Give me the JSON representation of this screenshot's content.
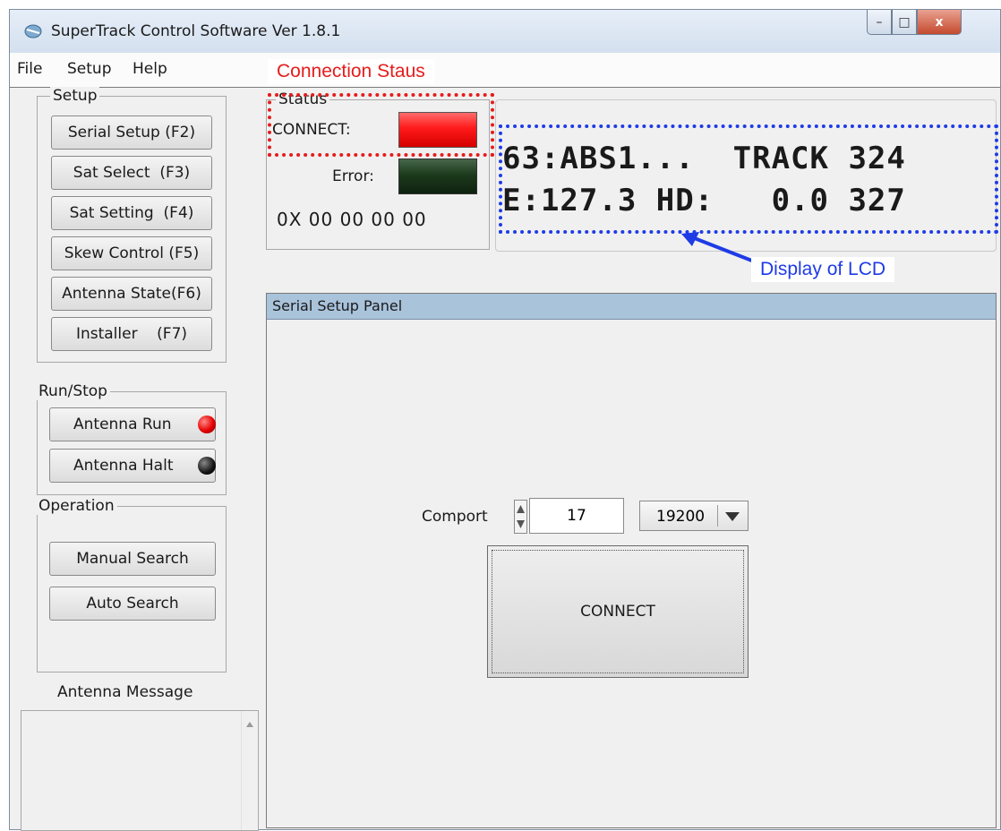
{
  "window": {
    "title": "SuperTrack Control Software Ver 1.8.1",
    "controls": {
      "minimize": "–",
      "maximize": "□",
      "close": "x"
    }
  },
  "menu": {
    "file": "File",
    "setup": "Setup",
    "help": "Help"
  },
  "setup_group": {
    "label": "Setup",
    "buttons": [
      {
        "label": "Serial Setup (F2)"
      },
      {
        "label": "Sat Select  (F3)"
      },
      {
        "label": "Sat Setting  (F4)"
      },
      {
        "label": "Skew Control (F5)"
      },
      {
        "label": "Antenna State(F6)"
      },
      {
        "label": "Installer    (F7)"
      }
    ]
  },
  "runstop_group": {
    "label": "Run/Stop",
    "run_label": "Antenna Run",
    "halt_label": "Antenna Halt",
    "run_led_color": "#e60000",
    "halt_led_color": "#111111"
  },
  "operation_group": {
    "label": "Operation",
    "manual_search": "Manual Search",
    "auto_search": "Auto Search"
  },
  "antenna_message": {
    "label": "Antenna Message"
  },
  "status_group": {
    "label": "Status",
    "connect_label": "CONNECT:",
    "error_label": "Error:",
    "code": "0X 00 00 00 00",
    "connect_color": "#ff1a1a",
    "error_color": "#1c3a1c"
  },
  "lcd": {
    "line1": "63:ABS1...  TRACK 324",
    "line2": "E:127.3 HD:   0.0 327"
  },
  "serial_panel": {
    "title": "Serial Setup Panel",
    "comport_label": "Comport",
    "comport_value": "17",
    "baud_value": "19200",
    "connect_button": "CONNECT"
  },
  "annotations": {
    "connection_status": "Connection Staus",
    "lcd_display": "Display of LCD",
    "red": "#e51c1c",
    "blue": "#1e3be6"
  }
}
